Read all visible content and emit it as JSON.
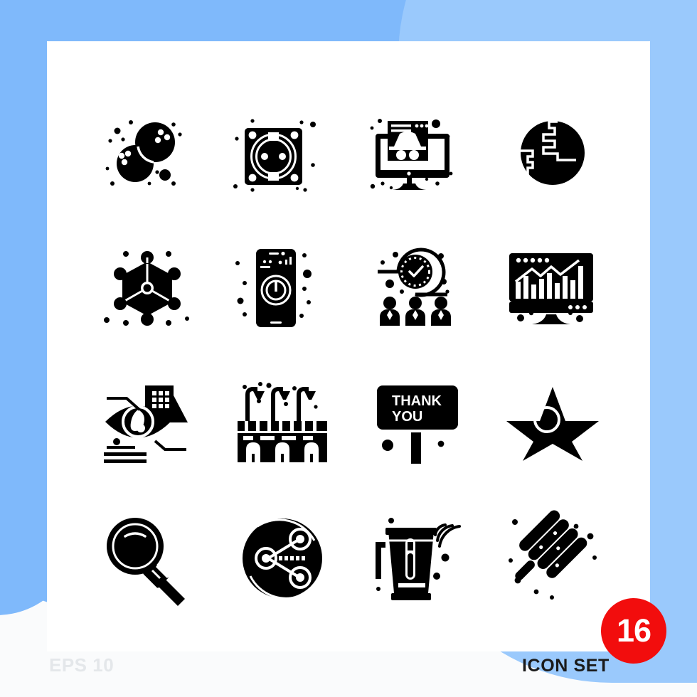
{
  "page": {
    "title": "Icon Set Sheet",
    "background_color": "#7fb9fb",
    "background_color_light": "#9ac9fc",
    "panel_color": "#ffffff"
  },
  "footer": {
    "eps_label": "EPS 10",
    "set_label": "ICON SET",
    "badge_count": "16",
    "badge_color": "#f20d0d"
  },
  "grid": {
    "columns": 4,
    "rows": 4,
    "total": 16
  },
  "icons": [
    {
      "id": 1,
      "name": "bowling-balls-icon",
      "label": "Bowling Balls",
      "row": 1,
      "col": 1
    },
    {
      "id": 2,
      "name": "power-socket-icon",
      "label": "Power Socket",
      "row": 1,
      "col": 2
    },
    {
      "id": 3,
      "name": "monitor-incognito-icon",
      "label": "Monitor Incognito",
      "row": 1,
      "col": 3
    },
    {
      "id": 4,
      "name": "globe-earth-icon",
      "label": "Globe Earth",
      "row": 1,
      "col": 4
    },
    {
      "id": 5,
      "name": "molecule-network-icon",
      "label": "Molecule Network",
      "row": 2,
      "col": 1
    },
    {
      "id": 6,
      "name": "smartphone-power-icon",
      "label": "Smartphone Power",
      "row": 2,
      "col": 2
    },
    {
      "id": 7,
      "name": "team-deadline-icon",
      "label": "Team Deadline",
      "row": 2,
      "col": 3
    },
    {
      "id": 8,
      "name": "monitor-analytics-icon",
      "label": "Monitor Analytics",
      "row": 2,
      "col": 4
    },
    {
      "id": 9,
      "name": "eye-surveillance-icon",
      "label": "Eye Surveillance",
      "row": 3,
      "col": 1
    },
    {
      "id": 10,
      "name": "bridge-lamps-icon",
      "label": "Bridge With Lamps",
      "row": 3,
      "col": 2
    },
    {
      "id": 11,
      "name": "thank-you-sign-icon",
      "label": "Thank You Sign",
      "row": 3,
      "col": 3,
      "sign_line_1": "THANK",
      "sign_line_2": "YOU"
    },
    {
      "id": 12,
      "name": "star-circle-icon",
      "label": "Star",
      "row": 3,
      "col": 4
    },
    {
      "id": 13,
      "name": "magnifier-search-icon",
      "label": "Magnifier Search",
      "row": 4,
      "col": 1
    },
    {
      "id": 14,
      "name": "share-network-circle-icon",
      "label": "Share Network",
      "row": 4,
      "col": 2
    },
    {
      "id": 15,
      "name": "smart-blender-icon",
      "label": "Smart Blender",
      "row": 4,
      "col": 3
    },
    {
      "id": 16,
      "name": "popsicle-icecream-icon",
      "label": "Popsicle Ice Cream",
      "row": 4,
      "col": 4
    }
  ]
}
